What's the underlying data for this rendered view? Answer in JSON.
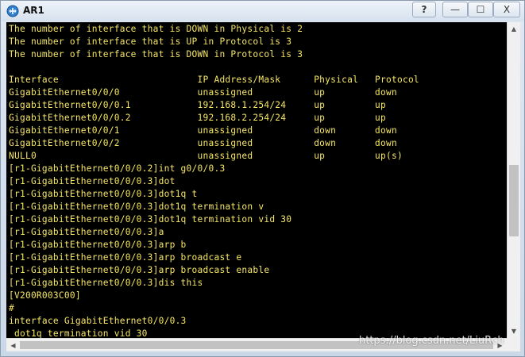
{
  "window": {
    "title": "AR1",
    "help_label": "?",
    "minimize_label": "—",
    "maximize_label": "☐",
    "close_label": "X"
  },
  "colors": {
    "terminal_background": "#000000",
    "terminal_text": "#f5e663"
  },
  "terminal": {
    "lines": [
      "The number of interface that is DOWN in Physical is 2",
      "The number of interface that is UP in Protocol is 3",
      "The number of interface that is DOWN in Protocol is 3",
      "",
      "Interface                         IP Address/Mask      Physical   Protocol",
      "GigabitEthernet0/0/0              unassigned           up         down",
      "GigabitEthernet0/0/0.1            192.168.1.254/24     up         up",
      "GigabitEthernet0/0/0.2            192.168.2.254/24     up         up",
      "GigabitEthernet0/0/1              unassigned           down       down",
      "GigabitEthernet0/0/2              unassigned           down       down",
      "NULL0                             unassigned           up         up(s)",
      "[r1-GigabitEthernet0/0/0.2]int g0/0/0.3",
      "[r1-GigabitEthernet0/0/0.3]dot",
      "[r1-GigabitEthernet0/0/0.3]dot1q t",
      "[r1-GigabitEthernet0/0/0.3]dot1q termination v",
      "[r1-GigabitEthernet0/0/0.3]dot1q termination vid 30",
      "[r1-GigabitEthernet0/0/0.3]a",
      "[r1-GigabitEthernet0/0/0.3]arp b",
      "[r1-GigabitEthernet0/0/0.3]arp broadcast e",
      "[r1-GigabitEthernet0/0/0.3]arp broadcast enable",
      "[r1-GigabitEthernet0/0/0.3]dis this",
      "[V200R003C00]",
      "#",
      "interface GigabitEthernet0/0/0.3",
      " dot1q termination vid 30"
    ]
  },
  "watermark": {
    "text": "https://blog.csdn.net/LiuRch"
  }
}
